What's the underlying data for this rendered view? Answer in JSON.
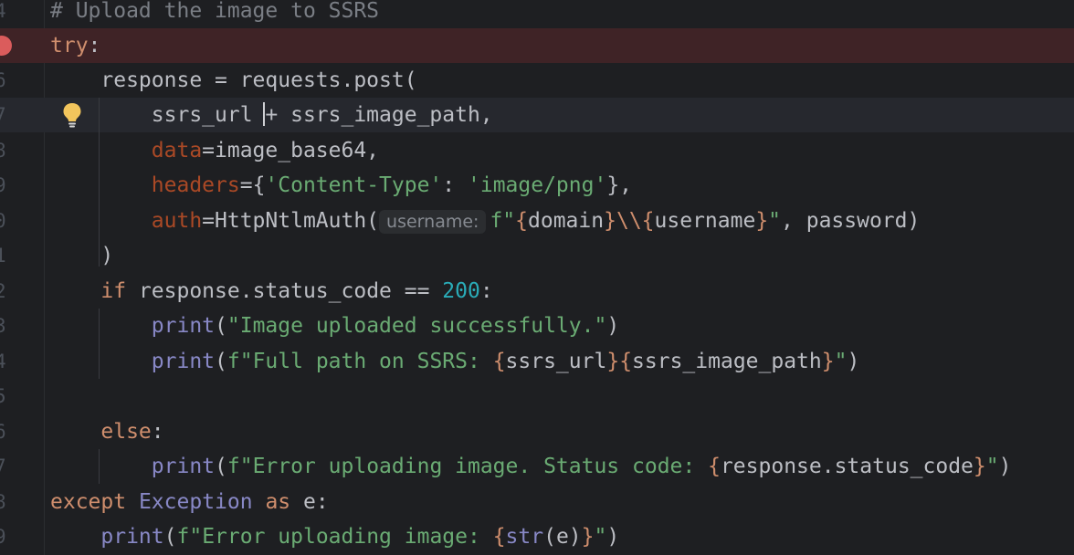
{
  "gutter": {
    "line_numbers": [
      "4",
      "",
      "6",
      "7",
      "8",
      "9",
      "0",
      "1",
      "2",
      "3",
      "4",
      "5",
      "6",
      "7",
      "8",
      "9"
    ]
  },
  "editor": {
    "comment": "# Upload the image to SSRS",
    "try_kw": "try",
    "colon": ":",
    "l6_var": "response = requests.post(",
    "l7_a": "ssrs_url ",
    "l7_b": "+ ssrs_image_path,",
    "l8_param": "data",
    "l8_rest": "=image_base64,",
    "l9_param": "headers",
    "l9_eqbrace": "={",
    "l9_key": "'Content-Type'",
    "l9_colon": ": ",
    "l9_val": "'image/png'",
    "l9_end": "},",
    "l10_param": "auth",
    "l10_call": "=HttpNtlmAuth(",
    "l10_hint": "username:",
    "l10_fq": "f\"",
    "l10_b1": "{",
    "l10_domain": "domain",
    "l10_b2": "}",
    "l10_esc": "\\\\",
    "l10_b3": "{",
    "l10_user": "username",
    "l10_b4": "}",
    "l10_q": "\"",
    "l10_end": ", password)",
    "l11": ")",
    "l12_if": "if",
    "l12_mid": " response.status_code == ",
    "l12_num": "200",
    "l12_colon": ":",
    "print_kw": "print",
    "l13_open": "(",
    "l13_str": "\"Image uploaded successfully.\"",
    "l13_close": ")",
    "l14_open": "(",
    "l14_str": "f\"Full path on SSRS: ",
    "l14_b1": "{",
    "l14_v1": "ssrs_url",
    "l14_b2": "}",
    "l14_b3": "{",
    "l14_v2": "ssrs_image_path",
    "l14_b4": "}",
    "l14_q": "\"",
    "l14_close": ")",
    "else_kw": "else",
    "l17_open": "(",
    "l17_str": "f\"Error uploading image. Status code: ",
    "l17_b1": "{",
    "l17_v": "response.status_code",
    "l17_b2": "}",
    "l17_q": "\"",
    "l17_close": ")",
    "except_kw": "except",
    "exception_cls": "Exception",
    "as_kw": "as",
    "l18_e": " e:",
    "l19_open": "(",
    "l19_str": "f\"Error uploading image: ",
    "l19_b1": "{",
    "l19_str_fn": "str",
    "l19_inner": "(e)",
    "l19_b2": "}",
    "l19_q": "\"",
    "l19_close": ")"
  },
  "colors": {
    "background": "#1e1f22",
    "keyword": "#cf8e6d",
    "comment": "#7a7e85",
    "string": "#6aab73",
    "number": "#2aacb8",
    "builtin": "#8888c6",
    "parameter": "#aa4926",
    "breakpoint": "#db5c5c",
    "breakpoint_line": "#3f2326"
  },
  "icons": {
    "breakpoint": "breakpoint-icon",
    "intention": "lightbulb-icon"
  }
}
